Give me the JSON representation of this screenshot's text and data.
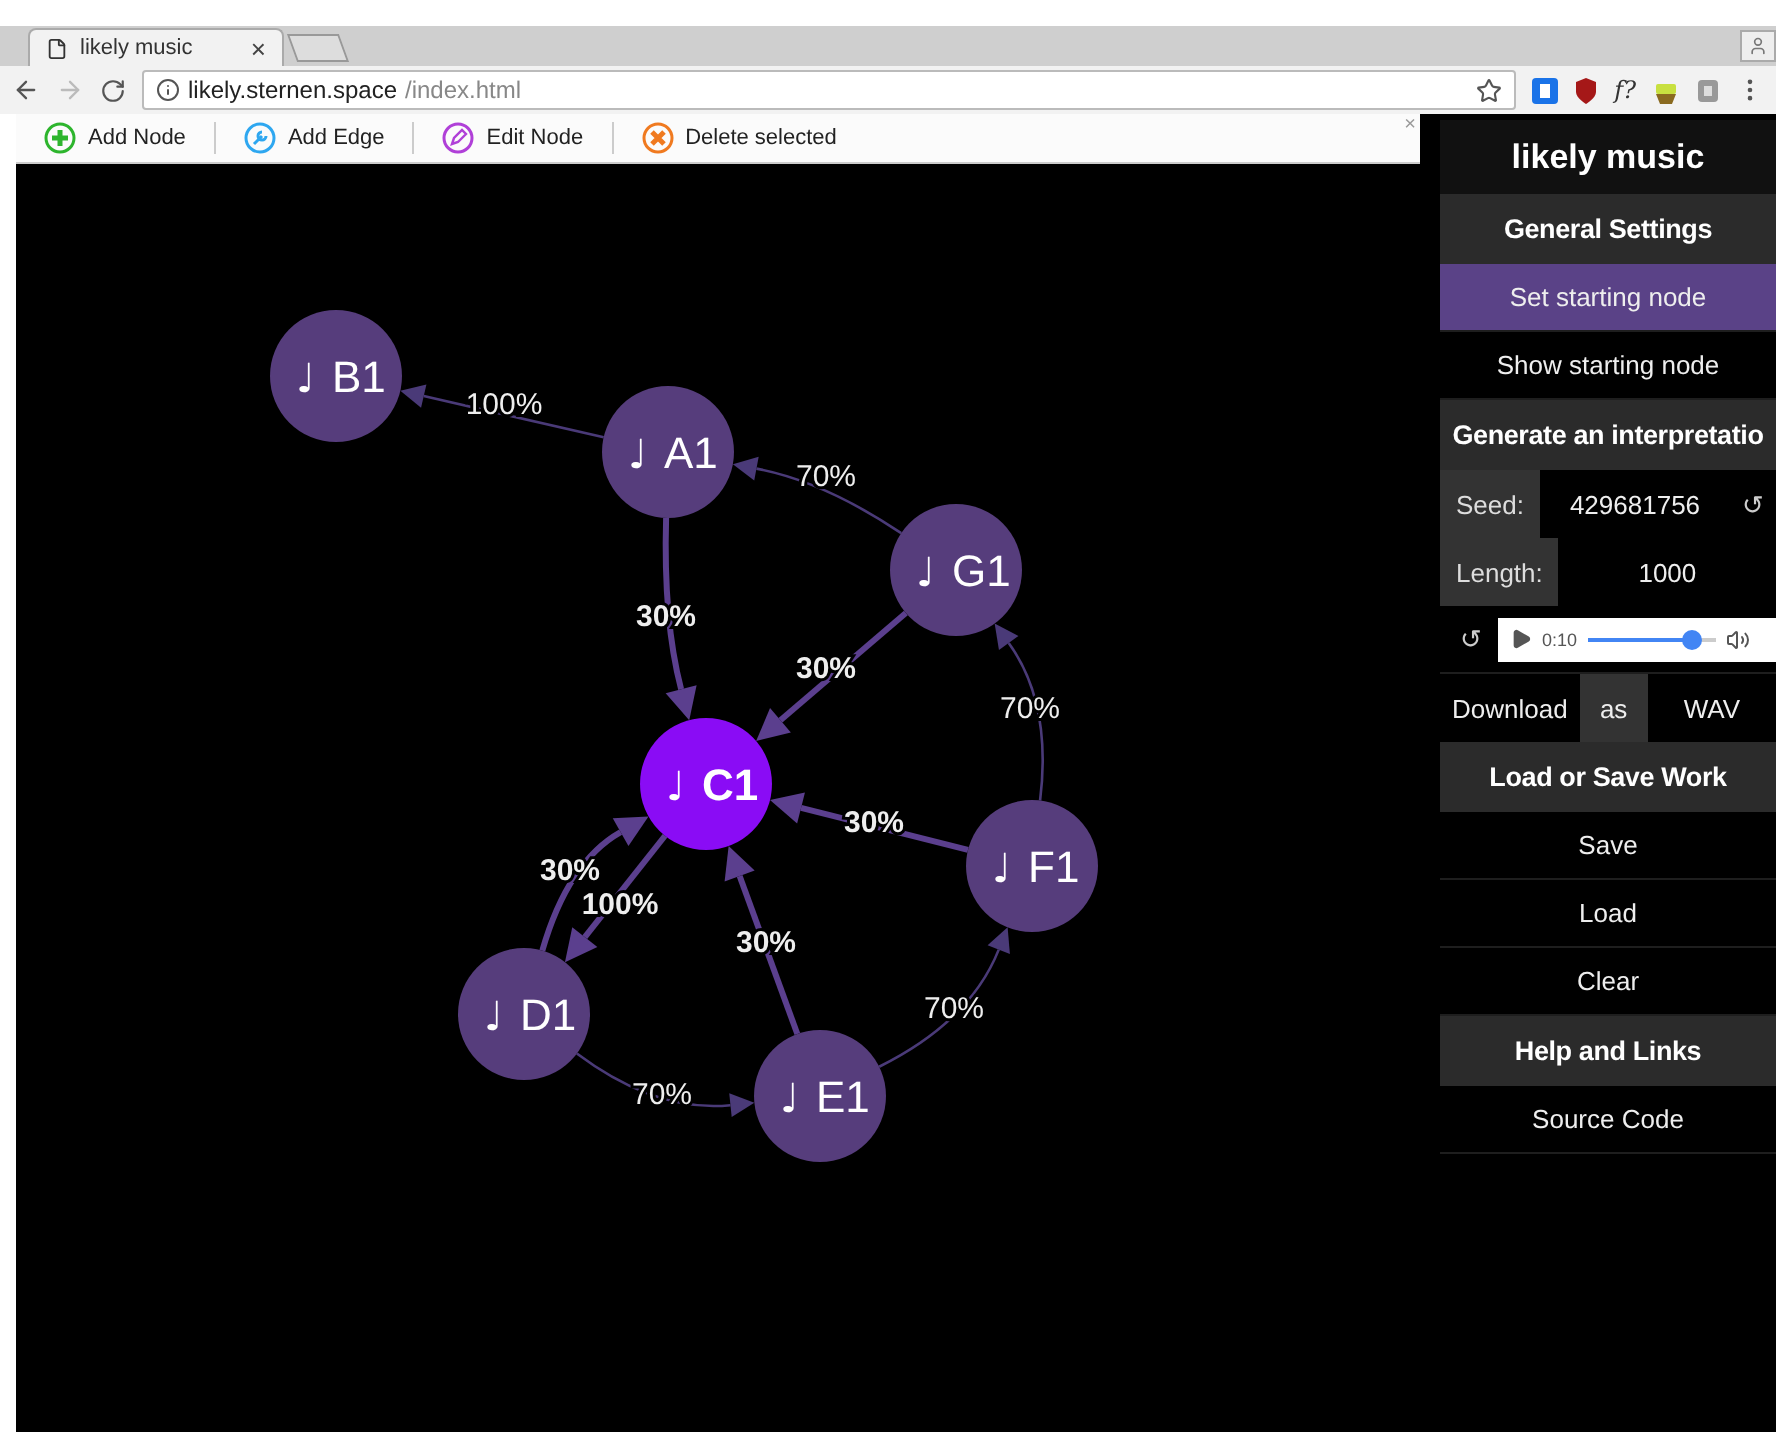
{
  "browser": {
    "tab": {
      "title": "likely music",
      "close": "×"
    },
    "url_host": "likely.sternen.space",
    "url_path": "/index.html",
    "extension_text": "f?"
  },
  "toolbar": {
    "buttons": [
      {
        "kind": "add",
        "label": "Add Node"
      },
      {
        "kind": "edge",
        "label": "Add Edge"
      },
      {
        "kind": "edit",
        "label": "Edit Node"
      },
      {
        "kind": "delete",
        "label": "Delete selected"
      }
    ],
    "close": "×"
  },
  "graph": {
    "nodes": [
      {
        "note": "♩",
        "name": "B1",
        "selected": false
      },
      {
        "note": "♩",
        "name": "A1",
        "selected": false
      },
      {
        "note": "♩",
        "name": "G1",
        "selected": false
      },
      {
        "note": "♩",
        "name": "C1",
        "selected": true
      },
      {
        "note": "♩",
        "name": "F1",
        "selected": false
      },
      {
        "note": "♩",
        "name": "D1",
        "selected": false
      },
      {
        "note": "♩",
        "name": "E1",
        "selected": false
      }
    ],
    "edges": [
      {
        "label": "100%"
      },
      {
        "label": "70%"
      },
      {
        "label": "30%"
      },
      {
        "label": "30%"
      },
      {
        "label": "70%"
      },
      {
        "label": "30%"
      },
      {
        "label": "30%"
      },
      {
        "label": "100%"
      },
      {
        "label": "30%"
      },
      {
        "label": "70%"
      },
      {
        "label": "70%"
      }
    ]
  },
  "sidebar": {
    "title": "likely music",
    "items": [
      {
        "kind": "header",
        "label": "General Settings"
      },
      {
        "kind": "button",
        "label": "Set starting node",
        "selected": true
      },
      {
        "kind": "button",
        "label": "Show starting node",
        "selected": false
      },
      {
        "kind": "header",
        "label": "Generate an interpretatio"
      },
      {
        "kind": "field",
        "label": "Seed:",
        "value": "429681756",
        "action": "↺"
      },
      {
        "kind": "field",
        "label": "Length:",
        "value": "1000"
      },
      {
        "kind": "player",
        "reload": "↺",
        "time": "0:10",
        "level": 0.82
      },
      {
        "kind": "download",
        "parts": [
          {
            "label": "Download",
            "selected": false
          },
          {
            "label": "as",
            "selected": true
          },
          {
            "label": "WAV",
            "selected": false
          }
        ]
      },
      {
        "kind": "header",
        "label": "Load or Save Work"
      },
      {
        "kind": "button",
        "label": "Save",
        "selected": false
      },
      {
        "kind": "button",
        "label": "Load",
        "selected": false
      },
      {
        "kind": "button",
        "label": "Clear",
        "selected": false
      },
      {
        "kind": "header",
        "label": "Help and Links"
      },
      {
        "kind": "button",
        "label": "Source Code",
        "selected": false
      }
    ]
  }
}
